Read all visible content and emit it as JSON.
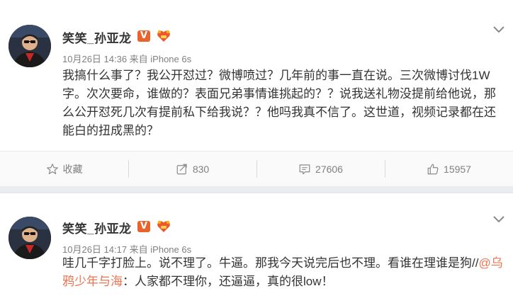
{
  "colors": {
    "background": "#e9edf0",
    "card": "#ffffff",
    "username": "#333333",
    "meta": "#808080",
    "mention": "#eb7350",
    "vip_badge": "#e8642c"
  },
  "posts": [
    {
      "username": "笑笑_孙亚龙",
      "vip_badge": "V",
      "meta": "10月26日 14:36 来自 iPhone 6s",
      "content": "我搞什么事了？我公开怼过？微博喷过？几年前的事一直在说。三次微博讨伐1W字。次次要命，谁做的？表面兄弟事情谁挑起的？？说我送礼物没提前给他说，那么公开怼死几次有提前私下给我说？？他吗我真不信了。这世道，视频记录都在还能白的扭成黑的？",
      "actions": {
        "favorite_label": "收藏",
        "repost_count": "830",
        "comment_count": "27606",
        "like_count": "15957"
      }
    },
    {
      "username": "笑笑_孙亚龙",
      "vip_badge": "V",
      "meta": "10月26日 14:17 来自 iPhone 6s",
      "content_before": "哇几千字打脸上。说不理了。牛逼。那我今天说完后也不理。看谁在理谁是狗//",
      "mention": "@乌鸦少年与海",
      "content_after": "：人家都不理你，还逼逼，真的很low！"
    }
  ]
}
